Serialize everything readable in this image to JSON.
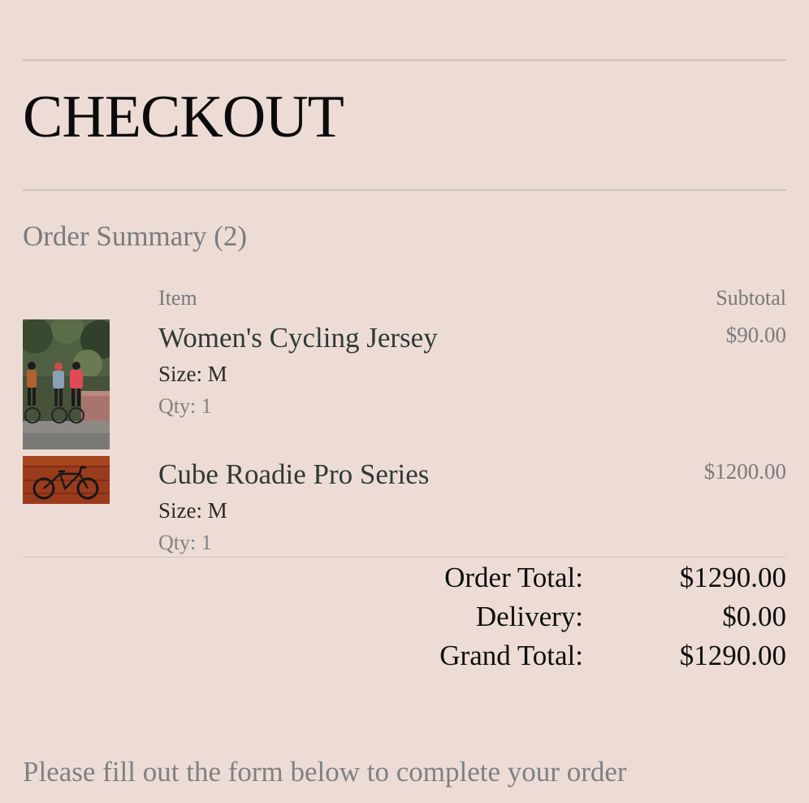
{
  "page": {
    "title": "CHECKOUT"
  },
  "summary": {
    "title": "Order Summary (2)",
    "columns": {
      "item": "Item",
      "subtotal": "Subtotal"
    },
    "items": [
      {
        "name": "Women's Cycling Jersey",
        "size": "Size: M",
        "qty": "Qty: 1",
        "price": "$90.00",
        "image": "three-cyclists-photo"
      },
      {
        "name": "Cube Roadie Pro Series",
        "size": "Size: M",
        "qty": "Qty: 1",
        "price": "$1200.00",
        "image": "road-bike-photo"
      }
    ]
  },
  "totals": {
    "order_total_label": "Order Total:",
    "order_total_value": "$1290.00",
    "delivery_label": "Delivery:",
    "delivery_value": "$0.00",
    "grand_total_label": "Grand Total:",
    "grand_total_value": "$1290.00"
  },
  "footer": {
    "note": "Please fill out the form below to complete your order"
  },
  "colors": {
    "background": "#eddcd5",
    "divider": "#cdc2bf",
    "muted_text": "#7a7b7f",
    "item_name": "#2f3a36"
  }
}
